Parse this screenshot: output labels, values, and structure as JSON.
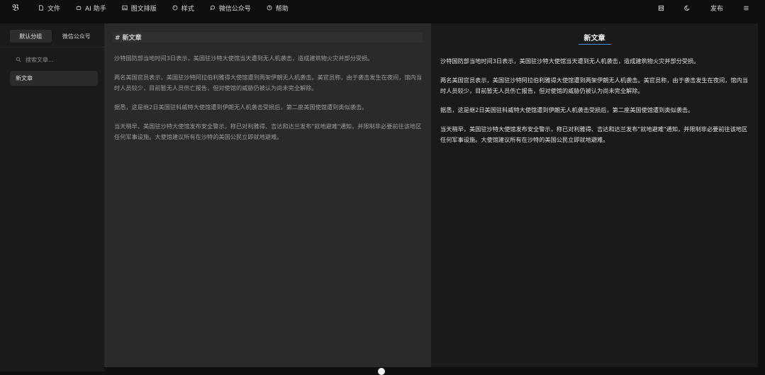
{
  "topbar": {
    "logo_text": "𝔅",
    "menu": [
      {
        "icon": "file-icon",
        "label": "文件"
      },
      {
        "icon": "ai-icon",
        "label": "AI 助手"
      },
      {
        "icon": "image-icon",
        "label": "图文排版"
      },
      {
        "icon": "palette-icon",
        "label": "样式"
      },
      {
        "icon": "wechat-icon",
        "label": "微信公众号"
      },
      {
        "icon": "help-icon",
        "label": "帮助"
      }
    ],
    "tools": {
      "save_icon": "save-icon",
      "theme_icon": "theme-icon",
      "publish_label": "发布",
      "menu_icon": "hamburger-icon"
    }
  },
  "sidebar": {
    "tabs": [
      "默认分组",
      "微信公众号"
    ],
    "search": {
      "placeholder": "搜索文章..."
    },
    "items": [
      {
        "label": "新文章"
      }
    ]
  },
  "editor": {
    "title": "# 新文章",
    "paragraphs": [
      "沙特国防部当地时间3日表示，美国驻沙特大使馆当天遭到无人机袭击，造成建筑物火灾并部分受损。",
      "两名美国官员表示，美国驻沙特阿拉伯利雅得大使馆遭到两架伊朗无人机袭击。美官员称，由于袭击发生在夜间，馆内当时人员较少，目前暂无人员伤亡报告，但对使馆的威胁仍被认为尚未完全解除。",
      "据悉，这是继2日美国驻科威特大使馆遭到伊朗无人机袭击受损后，第二座美国使馆遭到类似袭击。",
      "当天稍早，美国驻沙特大使馆发布安全警示，称已对利雅得、吉达和达兰发布\"就地避难\"通知，并限制非必要前往该地区任何军事设施。大使馆建议所有在沙特的美国公民立即就地避难。"
    ]
  },
  "preview": {
    "title": "新文章",
    "paragraphs": [
      "沙特国防部当地时间3日表示，美国驻沙特大使馆当天遭到无人机袭击，造成建筑物火灾并部分受损。",
      "两名美国官员表示，美国驻沙特阿拉伯利雅得大使馆遭到两架伊朗无人机袭击。美官员称，由于袭击发生在夜间，馆内当时人员较少，目前暂无人员伤亡报告，但对使馆的威胁仍被认为尚未完全解除。",
      "据悉，这是继2日美国驻科威特大使馆遭到伊朗无人机袭击受损后，第二座美国使馆遭到类似袭击。",
      "当天稍早，美国驻沙特大使馆发布安全警示，称已对利雅得、吉达和达兰发布\"就地避难\"通知，并限制非必要前往该地区任何军事设施。大使馆建议所有在沙特的美国公民立即就地避难。"
    ]
  },
  "colors": {
    "background": "#0f0f0f",
    "sidebar": "#1a1a1a",
    "editor": "#2a2a2a",
    "accent": "#4a90d9"
  }
}
